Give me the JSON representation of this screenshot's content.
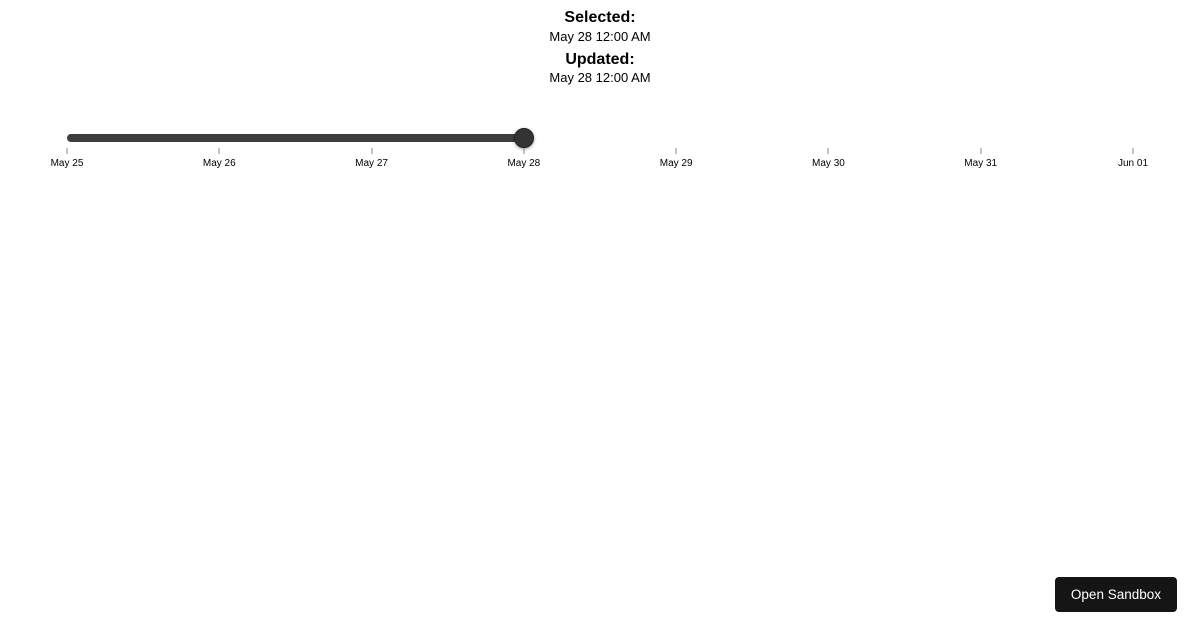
{
  "header": {
    "selected_label": "Selected:",
    "selected_value": "May 28 12:00 AM",
    "updated_label": "Updated:",
    "updated_value": "May 28 12:00 AM"
  },
  "slider": {
    "min_index": 0,
    "max_index": 7,
    "value_index": 3,
    "ticks": [
      {
        "label": "May 25"
      },
      {
        "label": "May 26"
      },
      {
        "label": "May 27"
      },
      {
        "label": "May 28"
      },
      {
        "label": "May 29"
      },
      {
        "label": "May 30"
      },
      {
        "label": "May 31"
      },
      {
        "label": "Jun 01"
      }
    ]
  },
  "sandbox": {
    "button_label": "Open Sandbox"
  }
}
